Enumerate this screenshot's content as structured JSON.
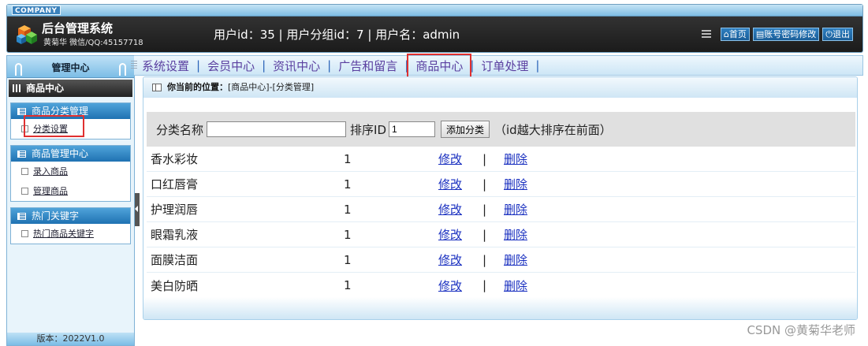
{
  "header": {
    "company": "COMPANY",
    "title": "后台管理系统",
    "subtitle": "黄菊华 微信/QQ:45157718",
    "user_info": "用户id：35 | 用户分组id：7 | 用户名：admin",
    "home_label": "首页",
    "password_label": "账号密码修改",
    "logout_label": "退出"
  },
  "sidebar": {
    "top_title": "管理中心",
    "current_section": "商品中心",
    "groups": [
      {
        "title": "商品分类管理",
        "items": [
          {
            "label": "分类设置"
          }
        ]
      },
      {
        "title": "商品管理中心",
        "items": [
          {
            "label": "录入商品"
          },
          {
            "label": "管理商品"
          }
        ]
      },
      {
        "title": "热门关键字",
        "items": [
          {
            "label": "热门商品关键字"
          }
        ]
      }
    ],
    "version": "版本：2022V1.0"
  },
  "nav": {
    "items": [
      "系统设置",
      "会员中心",
      "资讯中心",
      "广告和留言",
      "商品中心",
      "订单处理"
    ],
    "active": "商品中心",
    "separator": "|"
  },
  "location": {
    "label": "你当前的位置：",
    "path": "[商品中心]-[分类管理]"
  },
  "form": {
    "name_label": "分类名称",
    "name_value": "",
    "sort_label": "排序ID",
    "sort_value": "1",
    "add_button": "添加分类",
    "hint": "（id越大排序在前面）"
  },
  "categories": [
    {
      "name": "香水彩妆",
      "sort": "1",
      "edit": "修改",
      "delete": "删除"
    },
    {
      "name": "口红唇膏",
      "sort": "1",
      "edit": "修改",
      "delete": "删除"
    },
    {
      "name": "护理润唇",
      "sort": "1",
      "edit": "修改",
      "delete": "删除"
    },
    {
      "name": "眼霜乳液",
      "sort": "1",
      "edit": "修改",
      "delete": "删除"
    },
    {
      "name": "面膜洁面",
      "sort": "1",
      "edit": "修改",
      "delete": "删除"
    },
    {
      "name": "美白防晒",
      "sort": "1",
      "edit": "修改",
      "delete": "删除"
    }
  ],
  "watermark": "CSDN @黄菊华老师",
  "colors": {
    "highlight": "#e03030",
    "link": "#1a30c0",
    "nav_text": "#5a3fa0",
    "accent": "#1f72b2"
  }
}
